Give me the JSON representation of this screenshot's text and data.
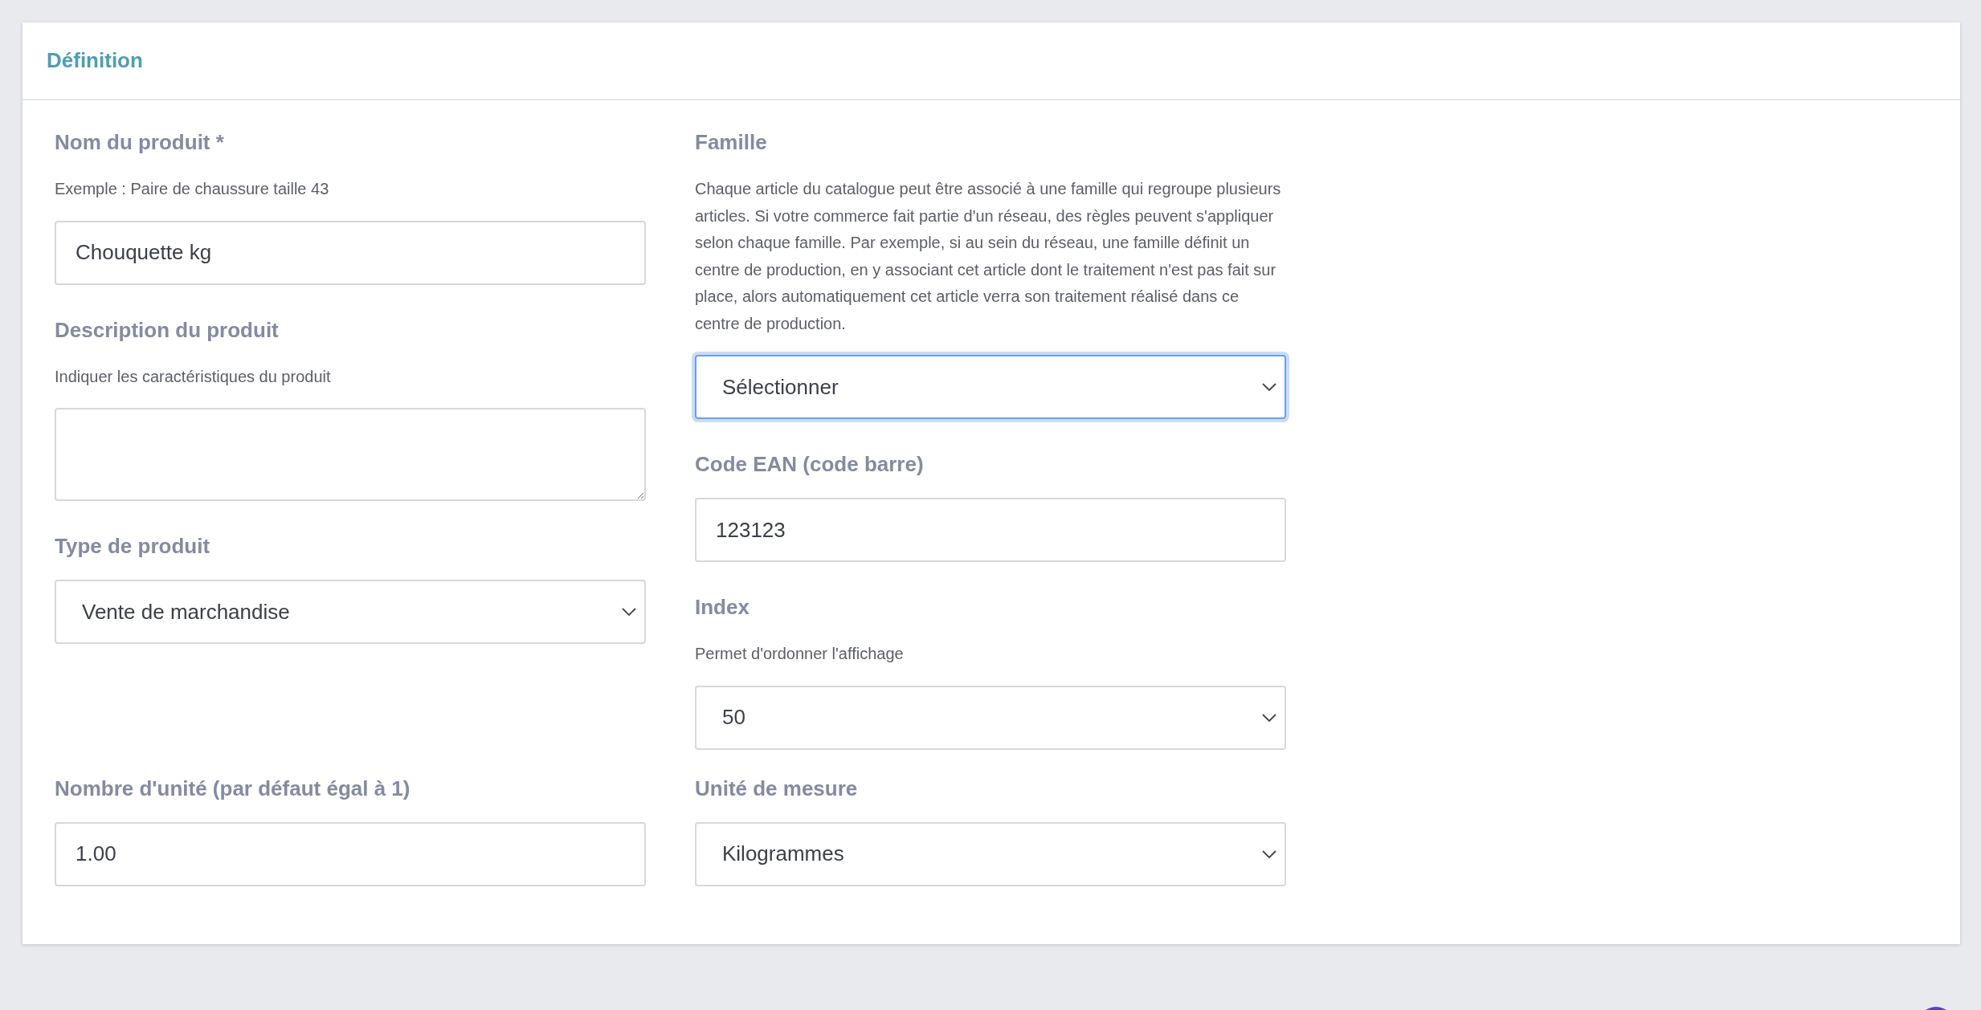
{
  "card": {
    "title": "Définition"
  },
  "left_column": [
    {
      "kind": "text",
      "label": "Nom du produit *",
      "helper": "Exemple : Paire de chaussure taille 43",
      "value": "Chouquette kg"
    },
    {
      "kind": "textarea",
      "label": "Description du produit",
      "helper": "Indiquer les caractéristiques du produit"
    },
    {
      "kind": "select",
      "label": "Type de produit",
      "value": "Vente de marchandise",
      "focused": false
    }
  ],
  "right_column": [
    {
      "kind": "select",
      "label": "Famille",
      "helper": "Chaque article du catalogue peut être associé à une famille qui regroupe plusieurs articles. Si votre commerce fait partie d'un réseau, des règles peuvent s'appliquer selon chaque famille. Par exemple, si au sein du réseau, une famille définit un centre de production, en y associant cet article dont le traitement n'est pas fait sur place, alors automatiquement cet article verra son traitement réalisé dans ce centre de production.",
      "value": "Sélectionner",
      "focused": true
    },
    {
      "kind": "text",
      "label": "Code EAN (code barre)",
      "value": "123123"
    },
    {
      "kind": "select",
      "label": "Index",
      "helper": "Permet d'ordonner l'affichage",
      "value": "50",
      "focused": false
    }
  ],
  "bottom_row": [
    {
      "kind": "text",
      "label": "Nombre d'unité (par défaut égal à 1)",
      "value": "1.00"
    },
    {
      "kind": "select",
      "label": "Unité de mesure",
      "value": "Kilogrammes",
      "focused": false
    }
  ]
}
